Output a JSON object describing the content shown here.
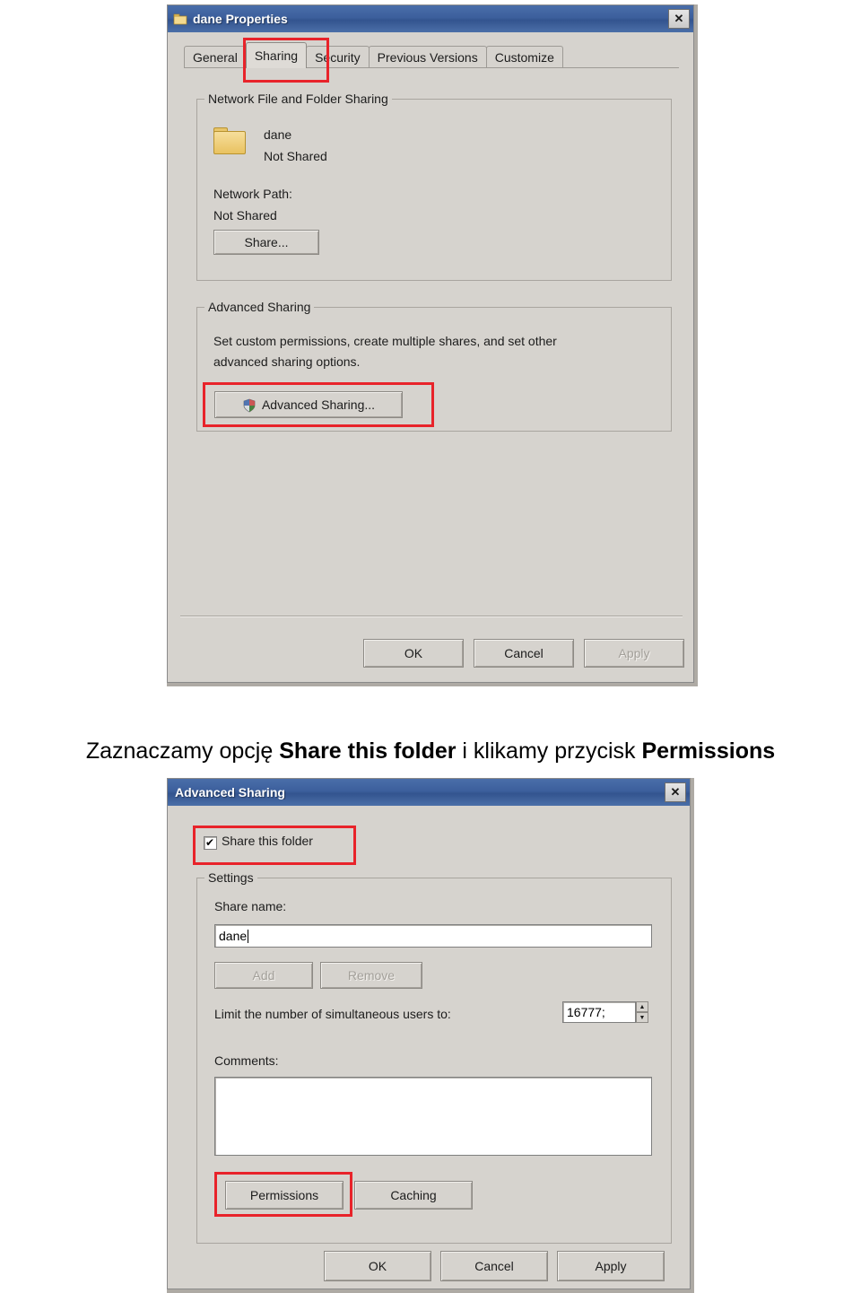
{
  "caption": {
    "pre": "Zaznaczamy opcję ",
    "bold1": "Share this folder",
    "mid": " i klikamy przycisk ",
    "bold2": "Permissions"
  },
  "window1": {
    "title": "dane Properties",
    "title_icon": "folder-icon",
    "close_label": "✕",
    "tabs": [
      {
        "label": "General",
        "active": false
      },
      {
        "label": "Sharing",
        "active": true
      },
      {
        "label": "Security",
        "active": false
      },
      {
        "label": "Previous Versions",
        "active": false
      },
      {
        "label": "Customize",
        "active": false
      }
    ],
    "group_network": {
      "legend": "Network File and Folder Sharing",
      "folder_icon": "folder-icon",
      "folder_name": "dane",
      "folder_state": "Not Shared",
      "path_label": "Network Path:",
      "path_value": "Not Shared",
      "share_button": "Share..."
    },
    "group_advanced": {
      "legend": "Advanced Sharing",
      "desc_line1": "Set custom permissions, create multiple shares, and set other",
      "desc_line2": "advanced sharing options.",
      "button_label": "Advanced Sharing...",
      "button_icon": "shield-icon"
    },
    "footer": {
      "ok": "OK",
      "cancel": "Cancel",
      "apply": "Apply",
      "apply_disabled": true
    }
  },
  "window2": {
    "title": "Advanced Sharing",
    "close_label": "✕",
    "share_checkbox": {
      "label": "Share this folder",
      "checked": true,
      "tick": "✔"
    },
    "settings": {
      "legend": "Settings",
      "share_name_label": "Share name:",
      "share_name_value": "dane",
      "add_button": "Add",
      "remove_button": "Remove",
      "limit_label": "Limit the number of simultaneous users to:",
      "limit_value": "16777;",
      "spin_up": "▲",
      "spin_down": "▼",
      "comments_label": "Comments:",
      "comments_value": "",
      "permissions_button": "Permissions",
      "caching_button": "Caching"
    },
    "footer": {
      "ok": "OK",
      "cancel": "Cancel",
      "apply": "Apply"
    }
  }
}
